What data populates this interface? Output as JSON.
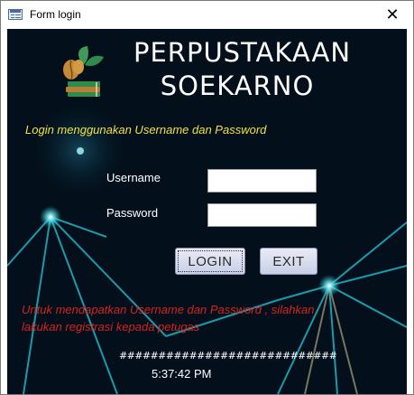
{
  "window": {
    "title": "Form login",
    "close_glyph": "✕"
  },
  "app": {
    "heading_line1": "PERPUSTAKAAN",
    "heading_line2": "SOEKARNO",
    "logo_icon": "books-leaf-logo-icon"
  },
  "login": {
    "instruction": "Login menggunakan Username dan Password",
    "username_label": "Username",
    "username_value": "",
    "password_label": "Password",
    "password_value": "",
    "login_button": "LOGIN",
    "exit_button": "EXIT"
  },
  "notice": {
    "line1": "Untuk mendapatkan Username dan Password , silahkan",
    "line2": "lakukan registrasi kepada petugas"
  },
  "status": {
    "hash_text": "############################",
    "clock": "5:37:42 PM"
  },
  "colors": {
    "background": "#03101c",
    "instruction_text": "#f2e23a",
    "notice_text": "#d8221c",
    "network_lines": "#1fb3c4"
  }
}
